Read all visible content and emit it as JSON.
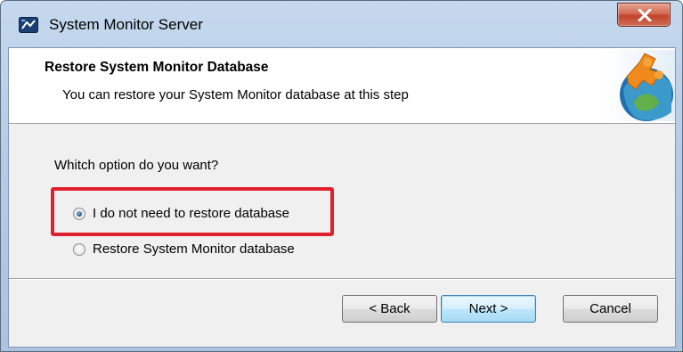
{
  "window": {
    "title": "System Monitor Server",
    "icons": {
      "app": "app-monitor-icon",
      "close": "close-icon"
    }
  },
  "header": {
    "title": "Restore System Monitor Database",
    "subtitle": "You can restore your System Monitor database at this step",
    "logo_icon": "puzzle-globe-logo-icon"
  },
  "content": {
    "question": "Whitch option do you want?",
    "options": [
      {
        "label": "I do not need to restore database",
        "selected": true
      },
      {
        "label": "Restore System Monitor database",
        "selected": false
      }
    ],
    "highlight_color": "#e0202c"
  },
  "buttons": {
    "back": "< Back",
    "next": "Next >",
    "cancel": "Cancel"
  }
}
